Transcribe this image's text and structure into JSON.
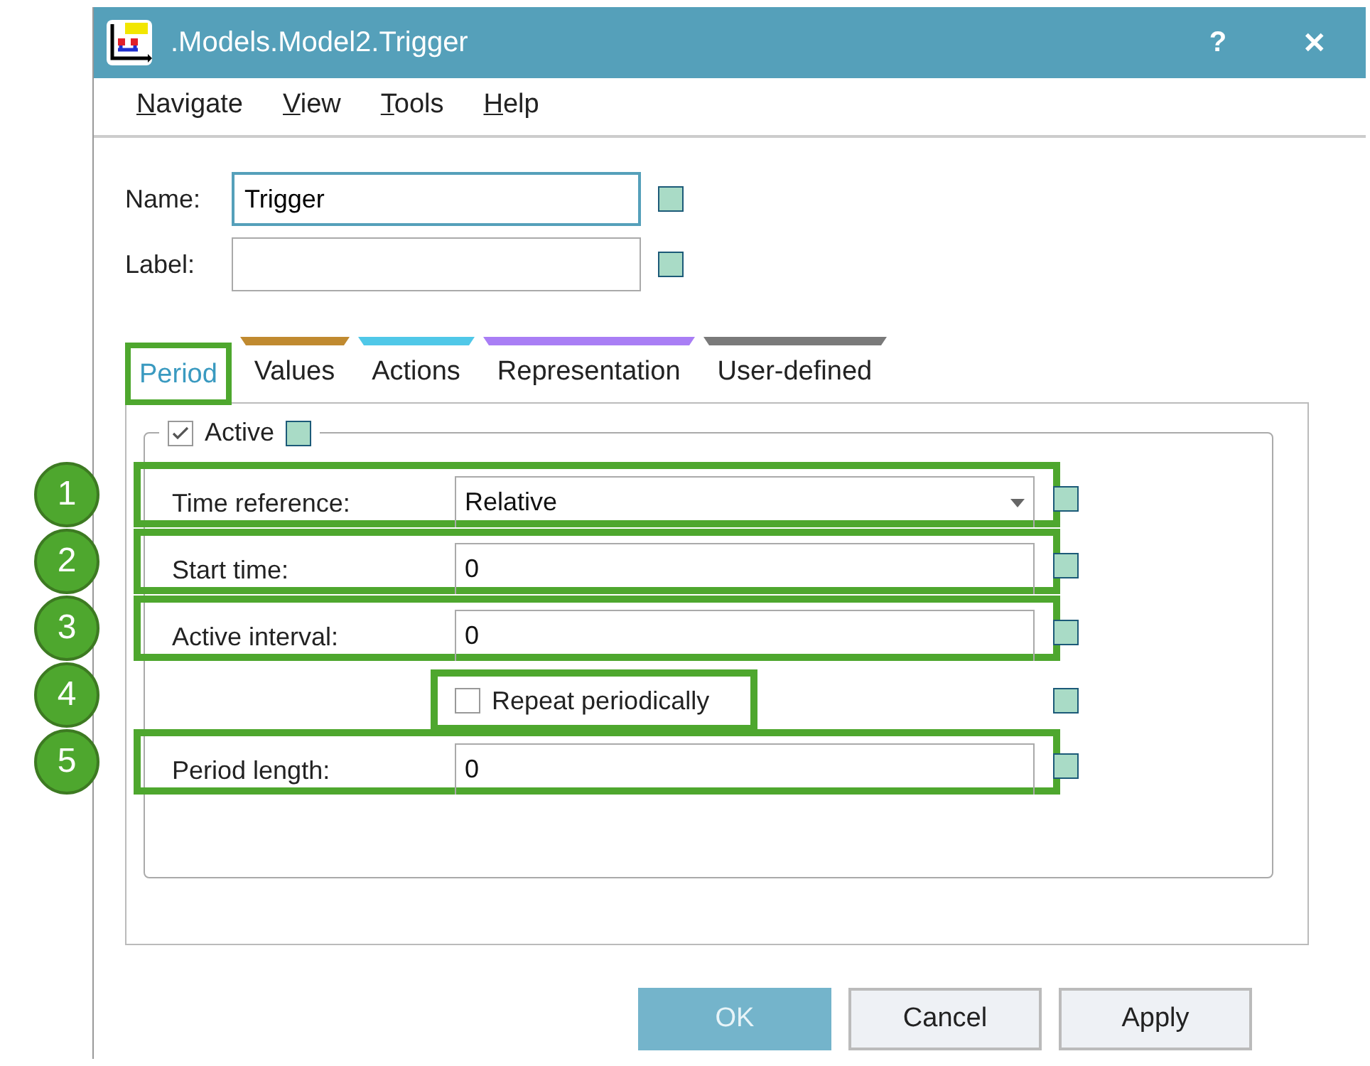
{
  "window": {
    "title": ".Models.Model2.Trigger",
    "help": "?",
    "close": "✕"
  },
  "menu": [
    {
      "mnemonic": "N",
      "rest": "avigate"
    },
    {
      "mnemonic": "V",
      "rest": "iew"
    },
    {
      "mnemonic": "T",
      "rest": "ools"
    },
    {
      "mnemonic": "H",
      "rest": "elp"
    }
  ],
  "fields": [
    {
      "label": "Name:",
      "value": "Trigger",
      "focused": true
    },
    {
      "label": "Label:",
      "focused": false
    }
  ],
  "tabs": [
    {
      "label": "Period",
      "selected": true,
      "highlighted": true
    },
    {
      "label": "Values",
      "selected": false,
      "highlighted": false,
      "color": "#c08a30"
    },
    {
      "label": "Actions",
      "selected": false,
      "highlighted": false,
      "color": "#50c8e8"
    },
    {
      "label": "Representation",
      "selected": false,
      "highlighted": false,
      "color": "#a97ef5"
    },
    {
      "label": "User-defined",
      "selected": false,
      "highlighted": false,
      "color": "#7a7a7a"
    }
  ],
  "group": {
    "label": "Active",
    "checked": true
  },
  "rows": [
    {
      "kind": "dropdown",
      "callout": "1",
      "label": "Time reference:",
      "value": "Relative",
      "highlighted": true
    },
    {
      "kind": "text",
      "callout": "2",
      "label": "Start time:",
      "value": "0",
      "highlighted": true
    },
    {
      "kind": "text",
      "callout": "3",
      "label": "Active interval:",
      "value": "0",
      "highlighted": true
    },
    {
      "kind": "checkbox",
      "callout": "4",
      "label": "Repeat periodically",
      "checked": false,
      "highlighted": true
    },
    {
      "kind": "text",
      "callout": "5",
      "label": "Period length:",
      "value": "0",
      "highlighted": true
    }
  ],
  "buttons": [
    {
      "label": "OK",
      "primary": true
    },
    {
      "label": "Cancel",
      "primary": false
    },
    {
      "label": "Apply",
      "primary": false
    }
  ]
}
